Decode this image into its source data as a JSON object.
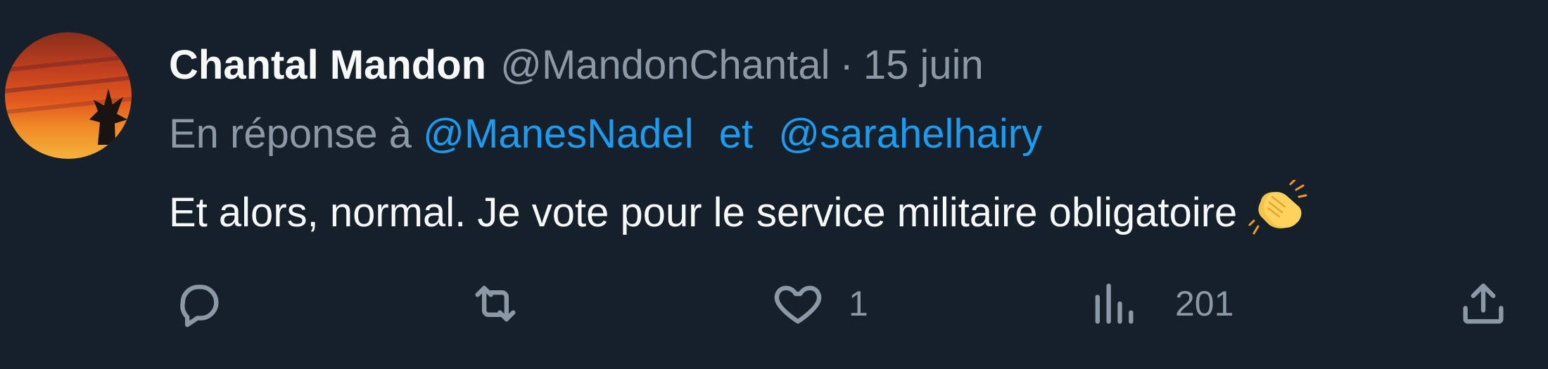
{
  "tweet": {
    "author_name": "Chantal Mandon",
    "author_handle": "@MandonChantal",
    "separator": "·",
    "date": "15 juin",
    "reply_prefix": "En réponse à",
    "reply_mentions": [
      "@ManesNadel",
      "@sarahelhairy"
    ],
    "reply_joiner": "et",
    "text": "Et alors, normal. Je vote pour le service militaire obligatoire",
    "emoji": "clapping-hands"
  },
  "actions": {
    "reply_icon": "reply-icon",
    "retweet_icon": "retweet-icon",
    "like_icon": "heart-icon",
    "like_count": "1",
    "views_icon": "views-icon",
    "views_count": "201",
    "share_icon": "share-icon"
  },
  "colors": {
    "background": "#15202b",
    "text_primary": "#f7f9f9",
    "text_secondary": "#8b98a5",
    "accent": "#1d9bf0"
  }
}
